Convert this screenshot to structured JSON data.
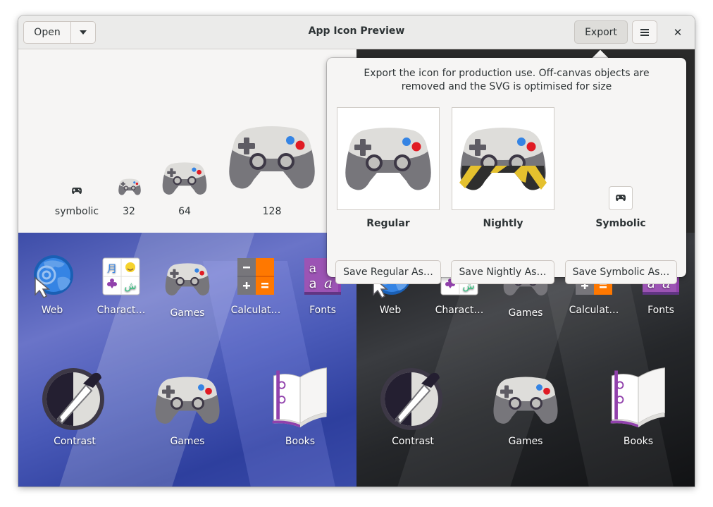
{
  "window": {
    "title": "App Icon Preview"
  },
  "header": {
    "open_label": "Open",
    "export_label": "Export"
  },
  "sizes": [
    "symbolic",
    "32",
    "64",
    "128"
  ],
  "popover": {
    "description": "Export the icon for production use. Off-canvas objects are removed and the SVG is optimised for size",
    "variants": [
      {
        "label": "Regular",
        "button": "Save Regular As…"
      },
      {
        "label": "Nightly",
        "button": "Save Nightly As…"
      },
      {
        "label": "Symbolic",
        "button": "Save Symbolic As…"
      }
    ]
  },
  "light_grid": {
    "small": [
      "Web",
      "Charact…",
      "Games",
      "Calculat…",
      "Fonts"
    ],
    "large": [
      "Contrast",
      "Games",
      "Books"
    ]
  },
  "dark_grid": {
    "small": [
      "Web",
      "Charact…",
      "Games",
      "Calculat…",
      "Fonts"
    ],
    "large": [
      "Contrast",
      "Games",
      "Books"
    ]
  },
  "icons": {
    "menu": "hamburger-icon",
    "close": "close-icon",
    "dropdown": "chevron-down-icon",
    "controller": "gamepad-icon",
    "web": "globe-icon",
    "chars": "characters-icon",
    "calc": "calculator-icon",
    "fonts": "fonts-icon",
    "contrast": "contrast-icon",
    "books": "books-icon"
  },
  "colors": {
    "accent_blue": "#3584e4",
    "accent_red": "#e01b24",
    "calc_orange": "#ff7800",
    "fonts_purple": "#9141ac"
  }
}
